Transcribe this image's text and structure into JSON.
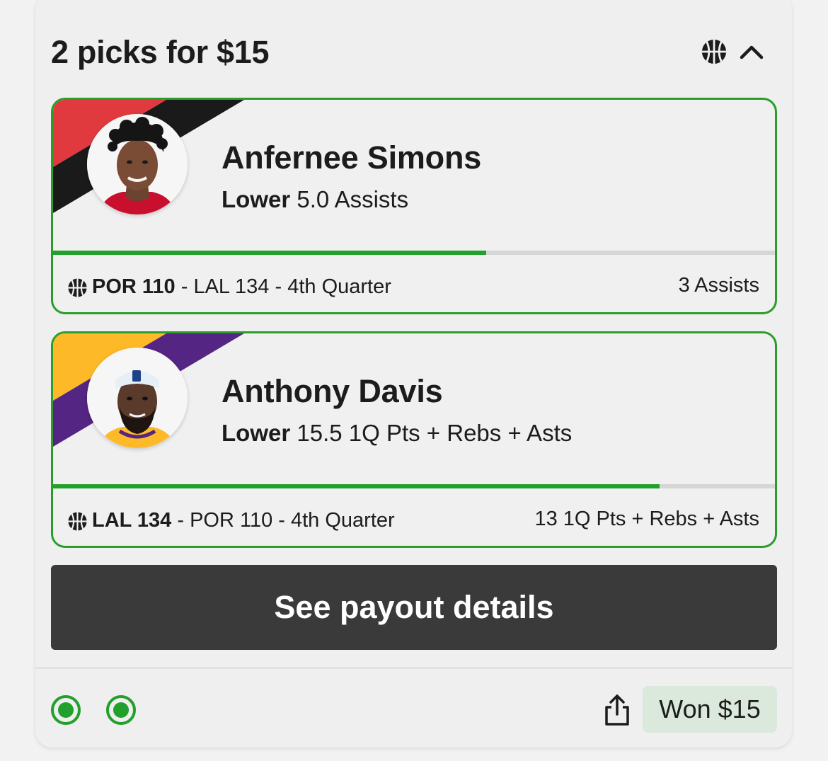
{
  "header": {
    "title": "2 picks for $15",
    "sport_icon": "basketball-icon",
    "collapse_icon": "chevron-up-icon"
  },
  "picks": [
    {
      "player": "Anfernee Simons",
      "direction": "Lower",
      "line": "5.0 Assists",
      "progress": 0.6,
      "team_colors": [
        "#e03a3e",
        "#1a1a1a"
      ],
      "score_bold": "POR 110",
      "score_rest": " - LAL 134 - 4th Quarter",
      "result": "3 Assists"
    },
    {
      "player": "Anthony Davis",
      "direction": "Lower",
      "line": "15.5 1Q Pts + Rebs + Asts",
      "progress": 0.84,
      "team_colors": [
        "#fdb927",
        "#552583"
      ],
      "score_bold": "LAL 134",
      "score_rest": " - POR 110 - 4th Quarter",
      "result": "13 1Q Pts + Rebs + Asts"
    }
  ],
  "payout_button": "See payout details",
  "footer": {
    "won_label": "Won $15",
    "share_icon": "share-icon",
    "status_icons": [
      "check-dot-icon",
      "check-dot-icon"
    ]
  },
  "colors": {
    "accent_green": "#2a9d2a",
    "button_dark": "#3a3a3a",
    "won_bg": "#dbe9dc"
  }
}
